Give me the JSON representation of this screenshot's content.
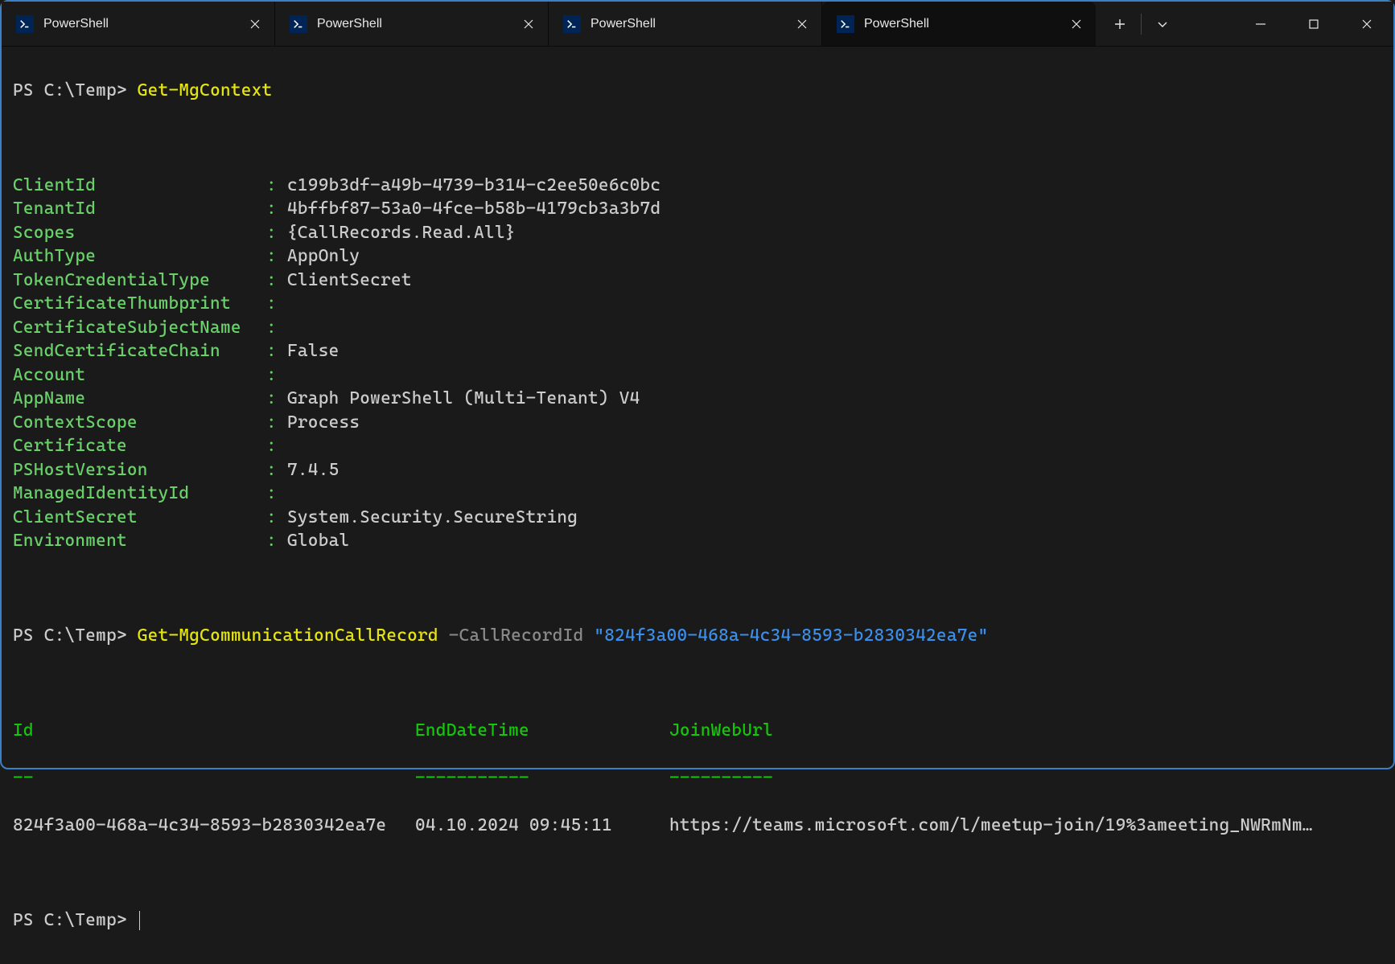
{
  "tabs": [
    {
      "title": "PowerShell",
      "active": false
    },
    {
      "title": "PowerShell",
      "active": false
    },
    {
      "title": "PowerShell",
      "active": false
    },
    {
      "title": "PowerShell",
      "active": true
    }
  ],
  "prompt": "PS C:\\Temp> ",
  "cmd1": "Get-MgContext",
  "context": [
    {
      "k": "ClientId",
      "v": "c199b3df-a49b-4739-b314-c2ee50e6c0bc"
    },
    {
      "k": "TenantId",
      "v": "4bffbf87-53a0-4fce-b58b-4179cb3a3b7d"
    },
    {
      "k": "Scopes",
      "v": "{CallRecords.Read.All}"
    },
    {
      "k": "AuthType",
      "v": "AppOnly"
    },
    {
      "k": "TokenCredentialType",
      "v": "ClientSecret"
    },
    {
      "k": "CertificateThumbprint",
      "v": ""
    },
    {
      "k": "CertificateSubjectName",
      "v": ""
    },
    {
      "k": "SendCertificateChain",
      "v": "False"
    },
    {
      "k": "Account",
      "v": ""
    },
    {
      "k": "AppName",
      "v": "Graph PowerShell (Multi-Tenant) V4"
    },
    {
      "k": "ContextScope",
      "v": "Process"
    },
    {
      "k": "Certificate",
      "v": ""
    },
    {
      "k": "PSHostVersion",
      "v": "7.4.5"
    },
    {
      "k": "ManagedIdentityId",
      "v": ""
    },
    {
      "k": "ClientSecret",
      "v": "System.Security.SecureString"
    },
    {
      "k": "Environment",
      "v": "Global"
    }
  ],
  "cmd2": {
    "name": "Get-MgCommunicationCallRecord",
    "param": "-CallRecordId",
    "value": "\"824f3a00-468a-4c34-8593-b2830342ea7e\""
  },
  "tableHeaders": {
    "id": "Id",
    "end": "EndDateTime",
    "url": "JoinWebUrl"
  },
  "tableDashes": {
    "id": "--",
    "end": "-----------",
    "url": "----------"
  },
  "tableRow": {
    "id": "824f3a00-468a-4c34-8593-b2830342ea7e",
    "end": "04.10.2024 09:45:11",
    "url": "https://teams.microsoft.com/l/meetup-join/19%3ameeting_NWRmNm…"
  }
}
